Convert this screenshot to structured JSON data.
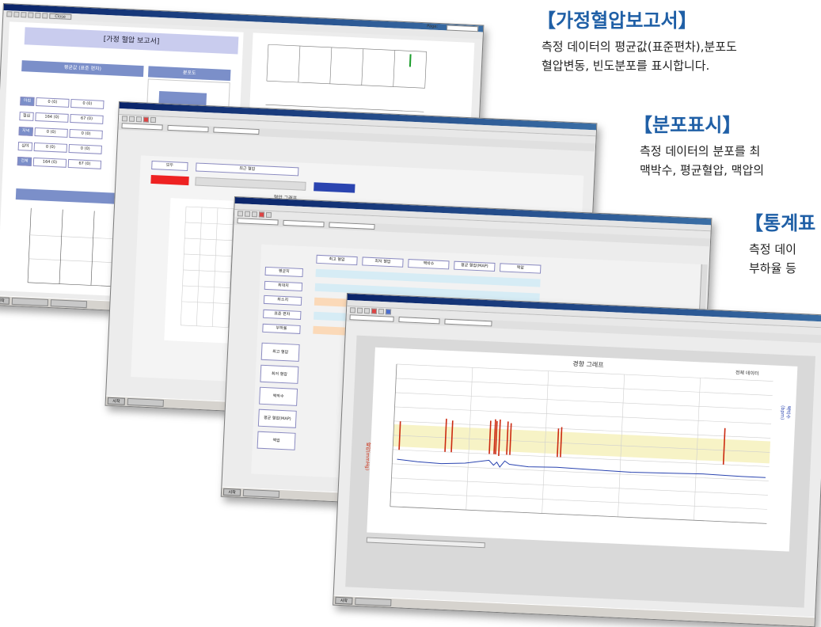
{
  "annotations": {
    "report": {
      "title": "【가정혈압보고서】",
      "line1": "측정 데이터의 평균값(표준편차),분포도",
      "line2": "혈압변동, 빈도분포를 표시합니다."
    },
    "distribution": {
      "title": "【분포표시】",
      "line1": "측정 데이터의 분포를 최",
      "line2": "맥박수, 평균혈압, 맥압의"
    },
    "statistics": {
      "title": "【통계표",
      "line1": "측정 데이",
      "line2": "부하율 등"
    }
  },
  "window1": {
    "toolbar_close": "Close",
    "page_label": "Page:",
    "report_title": "[가정 혈압 보고서]",
    "section_avg": "평균값 (표준 편차)",
    "section_dist": "분포도",
    "rows": [
      {
        "label": "아침",
        "v1": "0 (0)",
        "v2": "0 (0)"
      },
      {
        "label": "점심",
        "v1": "164 (0)",
        "v2": "67 (0)"
      },
      {
        "label": "저녁",
        "v1": "0 (0)",
        "v2": "0 (0)"
      },
      {
        "label": "심야",
        "v1": "0 (0)",
        "v2": "0 (0)"
      },
      {
        "label": "전체",
        "v1": "164 (0)",
        "v2": "67 (0)"
      }
    ],
    "taskbar_start": "시작"
  },
  "window2": {
    "tab_all": "모두",
    "tab_period": "최근 혈압",
    "chart_title": "혈압 그래프",
    "taskbar_start": "시작"
  },
  "window3": {
    "col_headers": [
      "최고 혈압",
      "최저 혈압",
      "맥박수",
      "평균 혈압(MAP)",
      "맥압"
    ],
    "row_labels": [
      "평균치",
      "최대치",
      "최소치",
      "표준 편차",
      "부하율",
      "최고 혈압",
      "최저 혈압",
      "맥박수",
      "평균 혈압(MAP)",
      "맥압"
    ],
    "taskbar_start": "시작"
  },
  "window4": {
    "chart_title": "경향 그래프",
    "legend_all": "전체 데이터",
    "y_left_label": "혈압(mmHg)",
    "y_right_label": "맥박수(bpm)",
    "taskbar_start": "시작"
  },
  "colors": {
    "systolic": "#cc2a10",
    "pulse": "#2a44b0",
    "band": "#f7f3c6",
    "title_blue": "#1f5fa6"
  }
}
